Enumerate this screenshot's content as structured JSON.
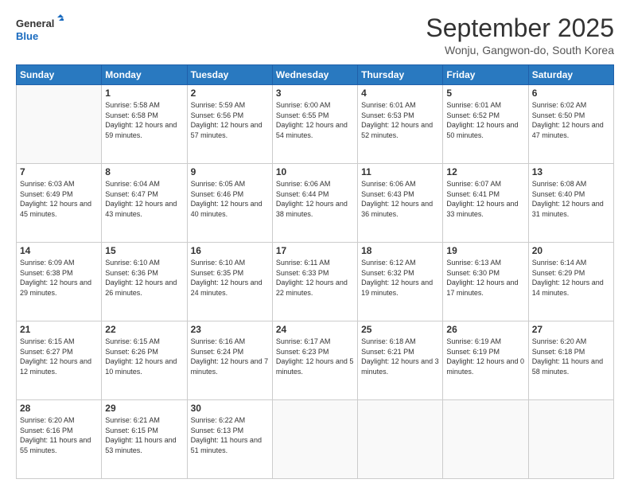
{
  "header": {
    "logo_line1": "General",
    "logo_line2": "Blue",
    "month": "September 2025",
    "location": "Wonju, Gangwon-do, South Korea"
  },
  "weekdays": [
    "Sunday",
    "Monday",
    "Tuesday",
    "Wednesday",
    "Thursday",
    "Friday",
    "Saturday"
  ],
  "weeks": [
    [
      {
        "day": null
      },
      {
        "day": "1",
        "sunrise": "5:58 AM",
        "sunset": "6:58 PM",
        "daylight": "12 hours and 59 minutes."
      },
      {
        "day": "2",
        "sunrise": "5:59 AM",
        "sunset": "6:56 PM",
        "daylight": "12 hours and 57 minutes."
      },
      {
        "day": "3",
        "sunrise": "6:00 AM",
        "sunset": "6:55 PM",
        "daylight": "12 hours and 54 minutes."
      },
      {
        "day": "4",
        "sunrise": "6:01 AM",
        "sunset": "6:53 PM",
        "daylight": "12 hours and 52 minutes."
      },
      {
        "day": "5",
        "sunrise": "6:01 AM",
        "sunset": "6:52 PM",
        "daylight": "12 hours and 50 minutes."
      },
      {
        "day": "6",
        "sunrise": "6:02 AM",
        "sunset": "6:50 PM",
        "daylight": "12 hours and 47 minutes."
      }
    ],
    [
      {
        "day": "7",
        "sunrise": "6:03 AM",
        "sunset": "6:49 PM",
        "daylight": "12 hours and 45 minutes."
      },
      {
        "day": "8",
        "sunrise": "6:04 AM",
        "sunset": "6:47 PM",
        "daylight": "12 hours and 43 minutes."
      },
      {
        "day": "9",
        "sunrise": "6:05 AM",
        "sunset": "6:46 PM",
        "daylight": "12 hours and 40 minutes."
      },
      {
        "day": "10",
        "sunrise": "6:06 AM",
        "sunset": "6:44 PM",
        "daylight": "12 hours and 38 minutes."
      },
      {
        "day": "11",
        "sunrise": "6:06 AM",
        "sunset": "6:43 PM",
        "daylight": "12 hours and 36 minutes."
      },
      {
        "day": "12",
        "sunrise": "6:07 AM",
        "sunset": "6:41 PM",
        "daylight": "12 hours and 33 minutes."
      },
      {
        "day": "13",
        "sunrise": "6:08 AM",
        "sunset": "6:40 PM",
        "daylight": "12 hours and 31 minutes."
      }
    ],
    [
      {
        "day": "14",
        "sunrise": "6:09 AM",
        "sunset": "6:38 PM",
        "daylight": "12 hours and 29 minutes."
      },
      {
        "day": "15",
        "sunrise": "6:10 AM",
        "sunset": "6:36 PM",
        "daylight": "12 hours and 26 minutes."
      },
      {
        "day": "16",
        "sunrise": "6:10 AM",
        "sunset": "6:35 PM",
        "daylight": "12 hours and 24 minutes."
      },
      {
        "day": "17",
        "sunrise": "6:11 AM",
        "sunset": "6:33 PM",
        "daylight": "12 hours and 22 minutes."
      },
      {
        "day": "18",
        "sunrise": "6:12 AM",
        "sunset": "6:32 PM",
        "daylight": "12 hours and 19 minutes."
      },
      {
        "day": "19",
        "sunrise": "6:13 AM",
        "sunset": "6:30 PM",
        "daylight": "12 hours and 17 minutes."
      },
      {
        "day": "20",
        "sunrise": "6:14 AM",
        "sunset": "6:29 PM",
        "daylight": "12 hours and 14 minutes."
      }
    ],
    [
      {
        "day": "21",
        "sunrise": "6:15 AM",
        "sunset": "6:27 PM",
        "daylight": "12 hours and 12 minutes."
      },
      {
        "day": "22",
        "sunrise": "6:15 AM",
        "sunset": "6:26 PM",
        "daylight": "12 hours and 10 minutes."
      },
      {
        "day": "23",
        "sunrise": "6:16 AM",
        "sunset": "6:24 PM",
        "daylight": "12 hours and 7 minutes."
      },
      {
        "day": "24",
        "sunrise": "6:17 AM",
        "sunset": "6:23 PM",
        "daylight": "12 hours and 5 minutes."
      },
      {
        "day": "25",
        "sunrise": "6:18 AM",
        "sunset": "6:21 PM",
        "daylight": "12 hours and 3 minutes."
      },
      {
        "day": "26",
        "sunrise": "6:19 AM",
        "sunset": "6:19 PM",
        "daylight": "12 hours and 0 minutes."
      },
      {
        "day": "27",
        "sunrise": "6:20 AM",
        "sunset": "6:18 PM",
        "daylight": "11 hours and 58 minutes."
      }
    ],
    [
      {
        "day": "28",
        "sunrise": "6:20 AM",
        "sunset": "6:16 PM",
        "daylight": "11 hours and 55 minutes."
      },
      {
        "day": "29",
        "sunrise": "6:21 AM",
        "sunset": "6:15 PM",
        "daylight": "11 hours and 53 minutes."
      },
      {
        "day": "30",
        "sunrise": "6:22 AM",
        "sunset": "6:13 PM",
        "daylight": "11 hours and 51 minutes."
      },
      {
        "day": null
      },
      {
        "day": null
      },
      {
        "day": null
      },
      {
        "day": null
      }
    ]
  ]
}
